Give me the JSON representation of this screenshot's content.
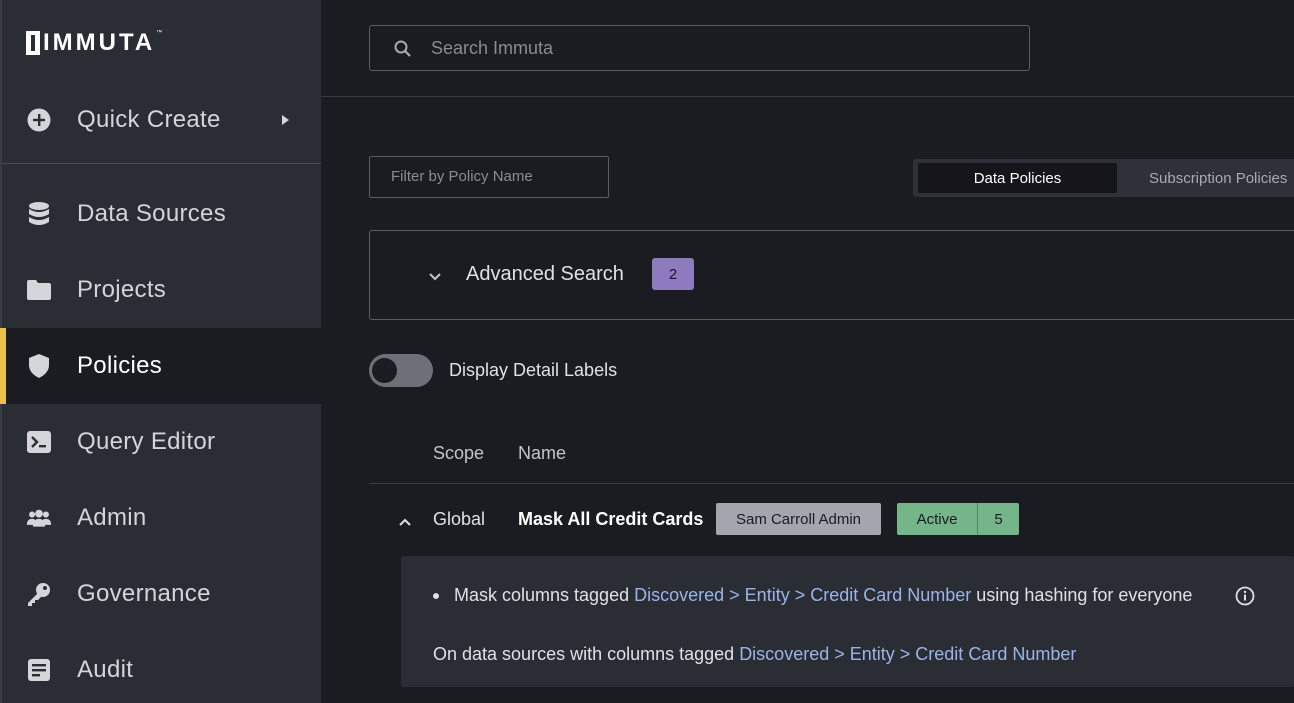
{
  "brand": {
    "name": "IMMUTA",
    "tm": "™"
  },
  "sidebar": {
    "quick_create": "Quick Create",
    "items": [
      {
        "label": "Data Sources",
        "icon": "database-icon"
      },
      {
        "label": "Projects",
        "icon": "folder-icon"
      },
      {
        "label": "Policies",
        "icon": "shield-icon",
        "active": true
      },
      {
        "label": "Query Editor",
        "icon": "terminal-icon"
      },
      {
        "label": "Admin",
        "icon": "people-icon"
      },
      {
        "label": "Governance",
        "icon": "key-icon"
      },
      {
        "label": "Audit",
        "icon": "document-icon"
      }
    ],
    "active_color": "#e8c04a"
  },
  "search": {
    "placeholder": "Search Immuta"
  },
  "filter": {
    "placeholder": "Filter by Policy Name"
  },
  "tabs": {
    "active": "Data Policies",
    "inactive": "Subscription Policies"
  },
  "advanced_search": {
    "label": "Advanced Search",
    "count": "2"
  },
  "toggle": {
    "label": "Display Detail Labels",
    "on": false
  },
  "table": {
    "columns": {
      "scope": "Scope",
      "name": "Name"
    },
    "rows": [
      {
        "scope": "Global",
        "name": "Mask All Credit Cards",
        "owner": "Sam Carroll Admin",
        "status": "Active",
        "count": "5",
        "detail": {
          "line1_prefix": "Mask columns tagged",
          "tag1": [
            "Discovered",
            "Entity",
            "Credit Card Number"
          ],
          "line1_suffix": "using hashing for everyone",
          "line2_prefix": "On data sources with columns tagged",
          "tag2": [
            "Discovered",
            "Entity",
            "Credit Card Number"
          ]
        }
      }
    ]
  },
  "colors": {
    "accent_purple": "#8e7bbf",
    "status_green": "#74b58a",
    "tag_blue": "#9bb4e8"
  }
}
